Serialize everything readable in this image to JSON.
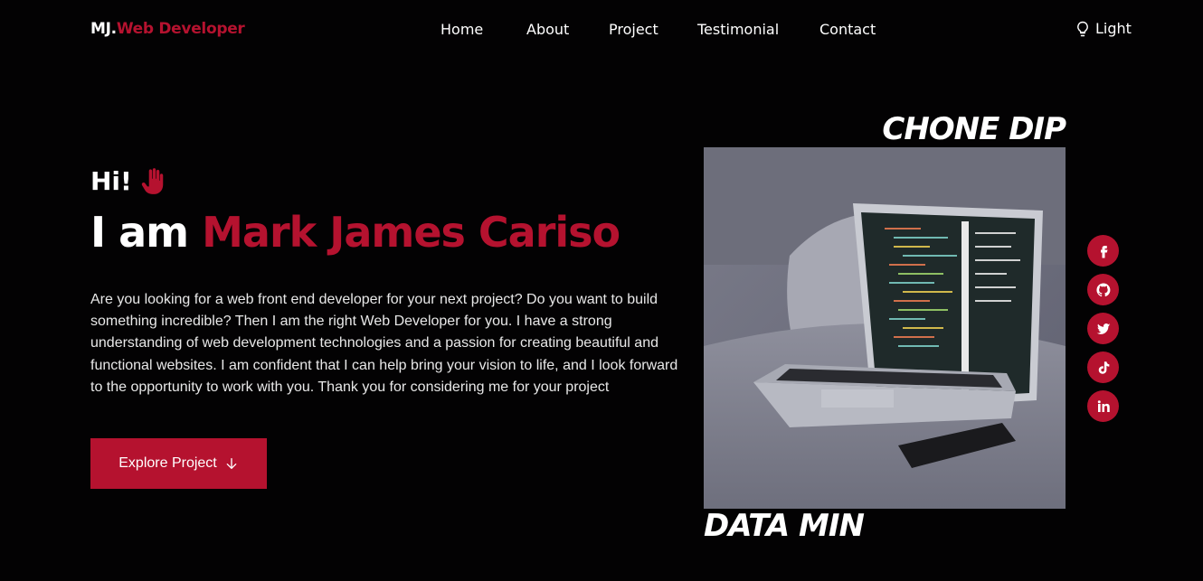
{
  "logo": {
    "prefix": "MJ.",
    "accent": "Web Developer"
  },
  "nav": {
    "items": [
      "Home",
      "About",
      "Project",
      "Testimonial",
      "Contact"
    ]
  },
  "theme_toggle": {
    "label": "Light",
    "icon": "lightbulb-icon"
  },
  "hero": {
    "greeting": "Hi!",
    "greeting_icon": "raised-hand-icon",
    "headline_prefix": "I am",
    "name": "Mark James Cariso",
    "intro": "Are you looking for a web front end developer for your next project? Do you want to build something incredible? Then I am the right Web Developer for you. I have a strong understanding of web development technologies and a passion for creating beautiful and functional websites. I am confident that I can help bring your vision to life, and I look forward to the opportunity to work with you. Thank you for considering me for your project",
    "cta_label": "Explore Project",
    "cta_icon": "arrow-down-icon"
  },
  "image_labels": {
    "top": "CHONE DIP",
    "bottom": "DATA MIN"
  },
  "social": [
    "facebook-icon",
    "github-icon",
    "twitter-icon",
    "tiktok-icon",
    "linkedin-icon"
  ],
  "colors": {
    "accent": "#b5122f",
    "background": "#030203",
    "text": "#ffffff"
  }
}
